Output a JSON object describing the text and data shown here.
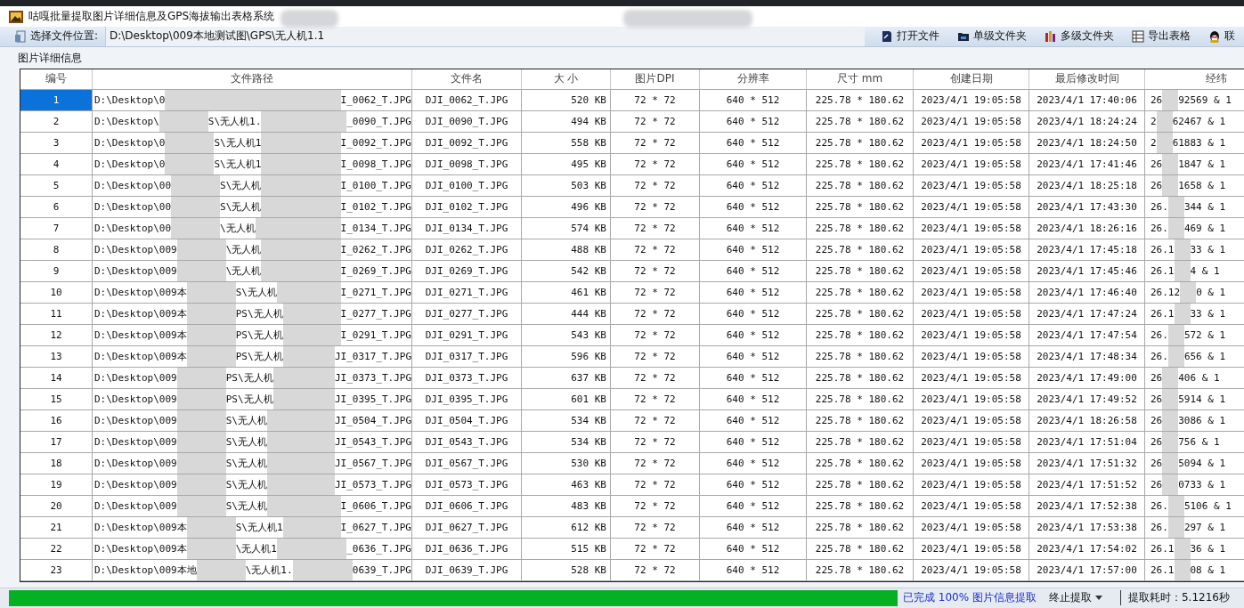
{
  "window": {
    "title": "咕嘎批量提取图片详细信息及GPS海拔输出表格系统"
  },
  "toolbar": {
    "location_label": "选择文件位置:",
    "location_value": "D:\\Desktop\\009本地测试图\\GPS\\无人机1.1",
    "buttons": [
      {
        "kind": "open",
        "label": "打开文件"
      },
      {
        "kind": "folder",
        "label": "单级文件夹"
      },
      {
        "kind": "books",
        "label": "多级文件夹"
      },
      {
        "kind": "table",
        "label": "导出表格"
      },
      {
        "kind": "penguin",
        "label": "联"
      }
    ]
  },
  "group_title": "图片详细信息",
  "table": {
    "columns": [
      "编号",
      "文件路径",
      "文件名",
      "大 小",
      "图片DPI",
      "分辨率",
      "尺寸 mm",
      "创建日期",
      "最后修改时间",
      "经纬"
    ],
    "rows": [
      {
        "selected": true,
        "no": "1",
        "path_head": "D:\\Desktop\\0",
        "path_tail": "I_0062_T.JPG",
        "name": "DJI_0062_T.JPG",
        "size": "520 KB",
        "dpi": "72 * 72",
        "res": "640 * 512",
        "dim": "225.78 * 180.62",
        "created": "2023/4/1 19:05:58",
        "modified": "2023/4/1 17:40:06",
        "coord_head": "26",
        "coord_tail": "92569 & 1"
      },
      {
        "selected": false,
        "no": "2",
        "path_head": "D:\\Desktop\\",
        "path_mid": "S\\无人机1.",
        "path_tail": "_0090_T.JPG",
        "name": "DJI_0090_T.JPG",
        "size": "494 KB",
        "dpi": "72 * 72",
        "res": "640 * 512",
        "dim": "225.78 * 180.62",
        "created": "2023/4/1 19:05:58",
        "modified": "2023/4/1 18:24:24",
        "coord_head": "2",
        "coord_tail": "62467 & 1"
      },
      {
        "selected": false,
        "no": "3",
        "path_head": "D:\\Desktop\\0",
        "path_mid": "S\\无人机1",
        "path_tail": "I_0092_T.JPG",
        "name": "DJI_0092_T.JPG",
        "size": "558 KB",
        "dpi": "72 * 72",
        "res": "640 * 512",
        "dim": "225.78 * 180.62",
        "created": "2023/4/1 19:05:58",
        "modified": "2023/4/1 18:24:50",
        "coord_head": "2",
        "coord_tail": "61883 & 1"
      },
      {
        "selected": false,
        "no": "4",
        "path_head": "D:\\Desktop\\0",
        "path_mid": "S\\无人机1",
        "path_tail": "I_0098_T.JPG",
        "name": "DJI_0098_T.JPG",
        "size": "495 KB",
        "dpi": "72 * 72",
        "res": "640 * 512",
        "dim": "225.78 * 180.62",
        "created": "2023/4/1 19:05:58",
        "modified": "2023/4/1 17:41:46",
        "coord_head": "26",
        "coord_tail": "1847 & 1"
      },
      {
        "selected": false,
        "no": "5",
        "path_head": "D:\\Desktop\\00",
        "path_mid": "S\\无人机",
        "path_tail": "I_0100_T.JPG",
        "name": "DJI_0100_T.JPG",
        "size": "503 KB",
        "dpi": "72 * 72",
        "res": "640 * 512",
        "dim": "225.78 * 180.62",
        "created": "2023/4/1 19:05:58",
        "modified": "2023/4/1 18:25:18",
        "coord_head": "26",
        "coord_tail": "1658 & 1"
      },
      {
        "selected": false,
        "no": "6",
        "path_head": "D:\\Desktop\\00",
        "path_mid": "S\\无人机",
        "path_tail": "I_0102_T.JPG",
        "name": "DJI_0102_T.JPG",
        "size": "496 KB",
        "dpi": "72 * 72",
        "res": "640 * 512",
        "dim": "225.78 * 180.62",
        "created": "2023/4/1 19:05:58",
        "modified": "2023/4/1 17:43:30",
        "coord_head": "26.",
        "coord_tail": "344 & 1"
      },
      {
        "selected": false,
        "no": "7",
        "path_head": "D:\\Desktop\\00",
        "path_mid": "\\无人机",
        "path_tail": "I_0134_T.JPG",
        "name": "DJI_0134_T.JPG",
        "size": "574 KB",
        "dpi": "72 * 72",
        "res": "640 * 512",
        "dim": "225.78 * 180.62",
        "created": "2023/4/1 19:05:58",
        "modified": "2023/4/1 18:26:16",
        "coord_head": "26.",
        "coord_tail": "469 & 1"
      },
      {
        "selected": false,
        "no": "8",
        "path_head": "D:\\Desktop\\009",
        "path_mid": "\\无人机",
        "path_tail": "I_0262_T.JPG",
        "name": "DJI_0262_T.JPG",
        "size": "488 KB",
        "dpi": "72 * 72",
        "res": "640 * 512",
        "dim": "225.78 * 180.62",
        "created": "2023/4/1 19:05:58",
        "modified": "2023/4/1 17:45:18",
        "coord_head": "26.1",
        "coord_tail": "33 & 1"
      },
      {
        "selected": false,
        "no": "9",
        "path_head": "D:\\Desktop\\009",
        "path_mid": "\\无人机",
        "path_tail": "I_0269_T.JPG",
        "name": "DJI_0269_T.JPG",
        "size": "542 KB",
        "dpi": "72 * 72",
        "res": "640 * 512",
        "dim": "225.78 * 180.62",
        "created": "2023/4/1 19:05:58",
        "modified": "2023/4/1 17:45:46",
        "coord_head": "26.1",
        "coord_tail": "4 & 1"
      },
      {
        "selected": false,
        "no": "10",
        "path_head": "D:\\Desktop\\009本",
        "path_mid": "S\\无人机",
        "path_tail": "I_0271_T.JPG",
        "name": "DJI_0271_T.JPG",
        "size": "461 KB",
        "dpi": "72 * 72",
        "res": "640 * 512",
        "dim": "225.78 * 180.62",
        "created": "2023/4/1 19:05:58",
        "modified": "2023/4/1 17:46:40",
        "coord_head": "26.12",
        "coord_tail": "0 & 1"
      },
      {
        "selected": false,
        "no": "11",
        "path_head": "D:\\Desktop\\009本",
        "path_mid": "PS\\无人机",
        "path_tail": "I_0277_T.JPG",
        "name": "DJI_0277_T.JPG",
        "size": "444 KB",
        "dpi": "72 * 72",
        "res": "640 * 512",
        "dim": "225.78 * 180.62",
        "created": "2023/4/1 19:05:58",
        "modified": "2023/4/1 17:47:24",
        "coord_head": "26.1",
        "coord_tail": "33 & 1"
      },
      {
        "selected": false,
        "no": "12",
        "path_head": "D:\\Desktop\\009本",
        "path_mid": "PS\\无人机",
        "path_tail": "I_0291_T.JPG",
        "name": "DJI_0291_T.JPG",
        "size": "543 KB",
        "dpi": "72 * 72",
        "res": "640 * 512",
        "dim": "225.78 * 180.62",
        "created": "2023/4/1 19:05:58",
        "modified": "2023/4/1 17:47:54",
        "coord_head": "26.",
        "coord_tail": "572 & 1"
      },
      {
        "selected": false,
        "no": "13",
        "path_head": "D:\\Desktop\\009本",
        "path_mid": "PS\\无人机",
        "path_tail": "JI_0317_T.JPG",
        "name": "DJI_0317_T.JPG",
        "size": "596 KB",
        "dpi": "72 * 72",
        "res": "640 * 512",
        "dim": "225.78 * 180.62",
        "created": "2023/4/1 19:05:58",
        "modified": "2023/4/1 17:48:34",
        "coord_head": "26.",
        "coord_tail": "656 & 1"
      },
      {
        "selected": false,
        "no": "14",
        "path_head": "D:\\Desktop\\009",
        "path_mid": "PS\\无人机",
        "path_tail": "JI_0373_T.JPG",
        "name": "DJI_0373_T.JPG",
        "size": "637 KB",
        "dpi": "72 * 72",
        "res": "640 * 512",
        "dim": "225.78 * 180.62",
        "created": "2023/4/1 19:05:58",
        "modified": "2023/4/1 17:49:00",
        "coord_head": "26",
        "coord_tail": "406 & 1"
      },
      {
        "selected": false,
        "no": "15",
        "path_head": "D:\\Desktop\\009",
        "path_mid": "PS\\无人机",
        "path_tail": "JI_0395_T.JPG",
        "name": "DJI_0395_T.JPG",
        "size": "601 KB",
        "dpi": "72 * 72",
        "res": "640 * 512",
        "dim": "225.78 * 180.62",
        "created": "2023/4/1 19:05:58",
        "modified": "2023/4/1 17:49:52",
        "coord_head": "26",
        "coord_tail": "5914 & 1"
      },
      {
        "selected": false,
        "no": "16",
        "path_head": "D:\\Desktop\\009",
        "path_mid": "S\\无人机",
        "path_tail": "JI_0504_T.JPG",
        "name": "DJI_0504_T.JPG",
        "size": "534 KB",
        "dpi": "72 * 72",
        "res": "640 * 512",
        "dim": "225.78 * 180.62",
        "created": "2023/4/1 19:05:58",
        "modified": "2023/4/1 18:26:58",
        "coord_head": "26",
        "coord_tail": "3086 & 1"
      },
      {
        "selected": false,
        "no": "17",
        "path_head": "D:\\Desktop\\009",
        "path_mid": "S\\无人机",
        "path_tail": "JI_0543_T.JPG",
        "name": "DJI_0543_T.JPG",
        "size": "534 KB",
        "dpi": "72 * 72",
        "res": "640 * 512",
        "dim": "225.78 * 180.62",
        "created": "2023/4/1 19:05:58",
        "modified": "2023/4/1 17:51:04",
        "coord_head": "26",
        "coord_tail": "756 & 1"
      },
      {
        "selected": false,
        "no": "18",
        "path_head": "D:\\Desktop\\009",
        "path_mid": "S\\无人机",
        "path_tail": "JI_0567_T.JPG",
        "name": "DJI_0567_T.JPG",
        "size": "530 KB",
        "dpi": "72 * 72",
        "res": "640 * 512",
        "dim": "225.78 * 180.62",
        "created": "2023/4/1 19:05:58",
        "modified": "2023/4/1 17:51:32",
        "coord_head": "26",
        "coord_tail": "5094 & 1"
      },
      {
        "selected": false,
        "no": "19",
        "path_head": "D:\\Desktop\\009",
        "path_mid": "S\\无人机",
        "path_tail": "JI_0573_T.JPG",
        "name": "DJI_0573_T.JPG",
        "size": "463 KB",
        "dpi": "72 * 72",
        "res": "640 * 512",
        "dim": "225.78 * 180.62",
        "created": "2023/4/1 19:05:58",
        "modified": "2023/4/1 17:51:52",
        "coord_head": "26",
        "coord_tail": "0733 & 1"
      },
      {
        "selected": false,
        "no": "20",
        "path_head": "D:\\Desktop\\009",
        "path_mid": "S\\无人机",
        "path_tail": "I_0606_T.JPG",
        "name": "DJI_0606_T.JPG",
        "size": "483 KB",
        "dpi": "72 * 72",
        "res": "640 * 512",
        "dim": "225.78 * 180.62",
        "created": "2023/4/1 19:05:58",
        "modified": "2023/4/1 17:52:38",
        "coord_head": "26.",
        "coord_tail": "5106 & 1"
      },
      {
        "selected": false,
        "no": "21",
        "path_head": "D:\\Desktop\\009本",
        "path_mid": "S\\无人机1",
        "path_tail": "I_0627_T.JPG",
        "name": "DJI_0627_T.JPG",
        "size": "612 KB",
        "dpi": "72 * 72",
        "res": "640 * 512",
        "dim": "225.78 * 180.62",
        "created": "2023/4/1 19:05:58",
        "modified": "2023/4/1 17:53:38",
        "coord_head": "26.",
        "coord_tail": "297 & 1"
      },
      {
        "selected": false,
        "no": "22",
        "path_head": "D:\\Desktop\\009本",
        "path_mid": "\\无人机1",
        "path_tail": "_0636_T.JPG",
        "name": "DJI_0636_T.JPG",
        "size": "515 KB",
        "dpi": "72 * 72",
        "res": "640 * 512",
        "dim": "225.78 * 180.62",
        "created": "2023/4/1 19:05:58",
        "modified": "2023/4/1 17:54:02",
        "coord_head": "26.1",
        "coord_tail": "36 & 1"
      },
      {
        "selected": false,
        "no": "23",
        "path_head": "D:\\Desktop\\009本地",
        "path_mid": "\\无人机1.",
        "path_tail": "0639_T.JPG",
        "name": "DJI_0639_T.JPG",
        "size": "528 KB",
        "dpi": "72 * 72",
        "res": "640 * 512",
        "dim": "225.78 * 180.62",
        "created": "2023/4/1 19:05:58",
        "modified": "2023/4/1 17:57:00",
        "coord_head": "26.1",
        "coord_tail": "08 & 1"
      }
    ]
  },
  "status_bar": {
    "level": 1,
    "message": "已完成 100% 图片信息提取",
    "dropdown": "终止提取",
    "elapsed": "提取耗时：5.1216秒"
  }
}
